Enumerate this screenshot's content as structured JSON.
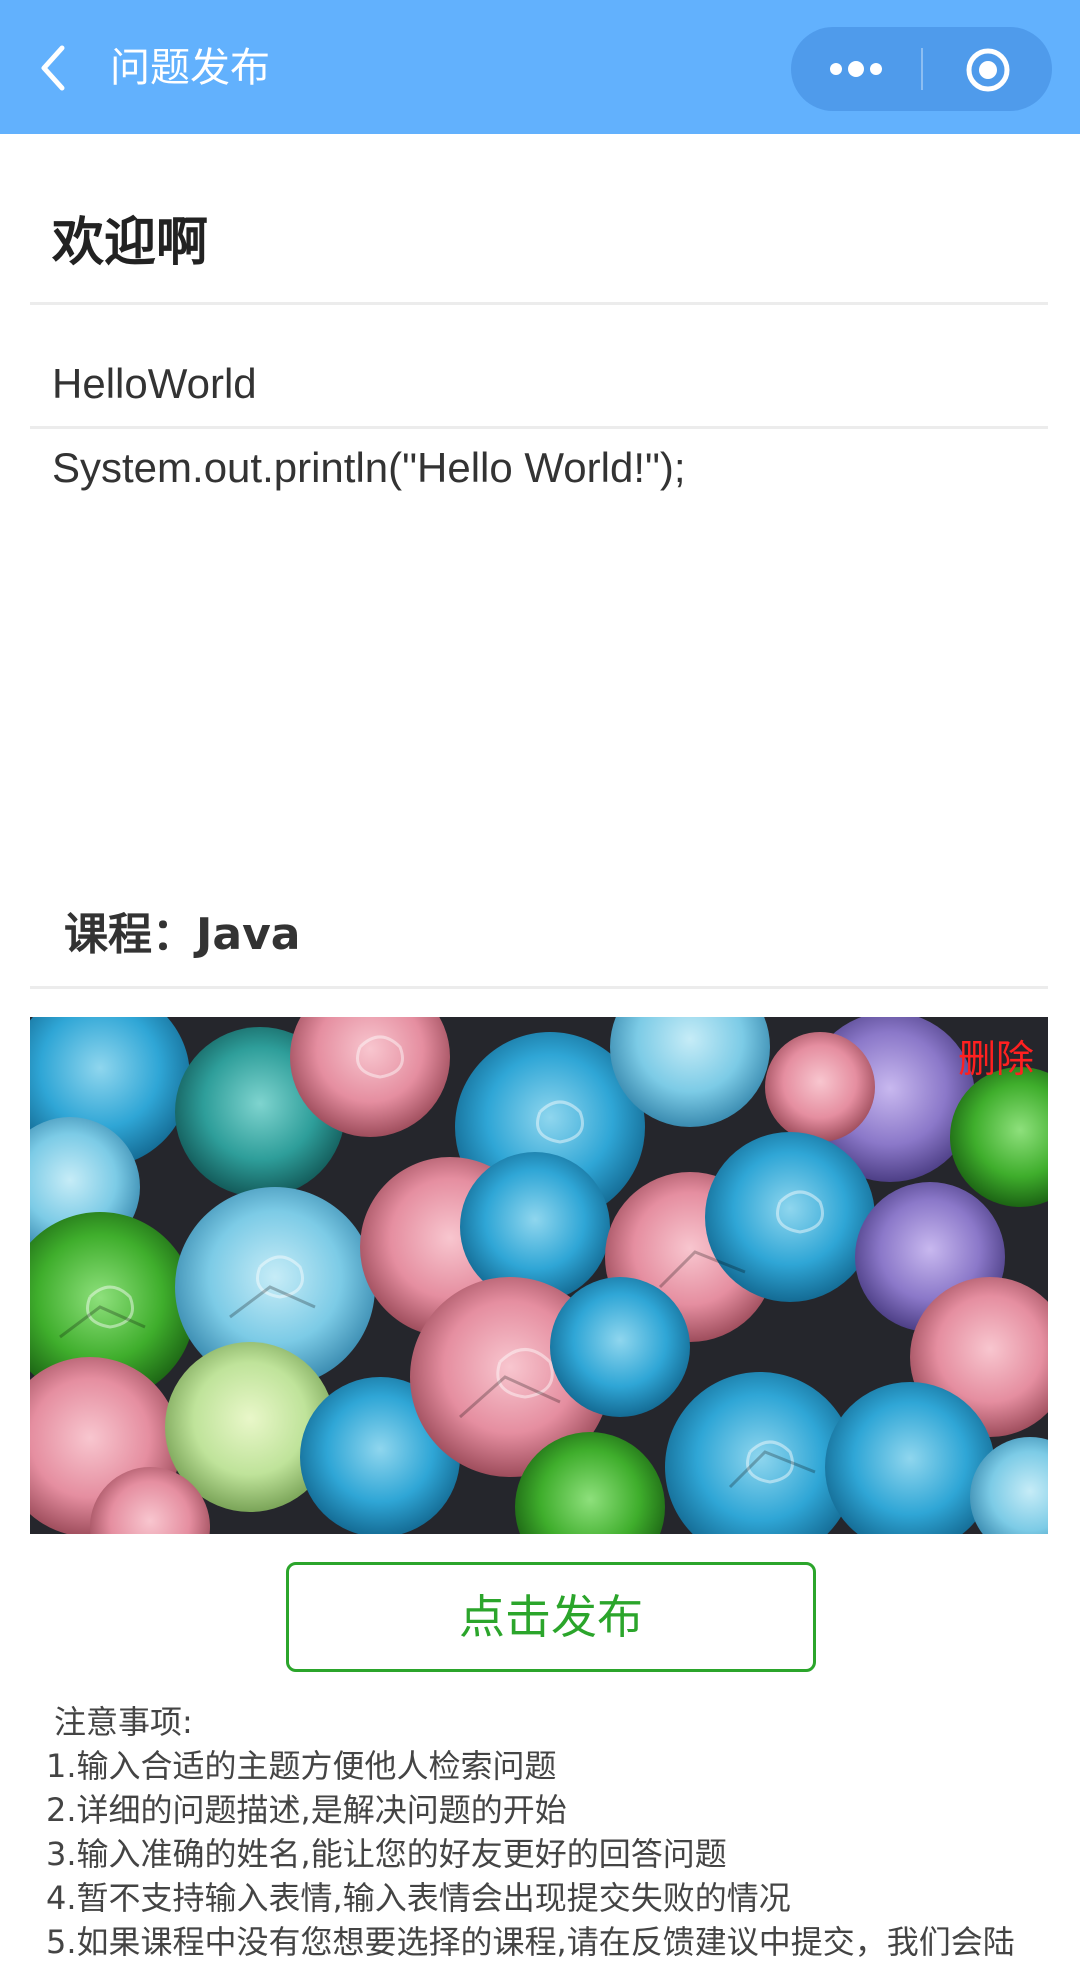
{
  "navbar": {
    "title": "问题发布",
    "back_icon": "chevron-left-icon",
    "more_icon": "more-dots-icon",
    "close_icon": "target-circle-icon",
    "background": "#62b1fd"
  },
  "form": {
    "welcome": "欢迎啊",
    "topic_value": "HelloWorld",
    "description_value": "System.out.println(\"Hello World!\");",
    "course_label": "课程：",
    "course_value": "Java"
  },
  "image": {
    "subject": "origami-paper-roses",
    "delete_label": "删除",
    "delete_color": "#ff2020"
  },
  "actions": {
    "publish_label": "点击发布",
    "publish_color": "#2ba52b"
  },
  "notes": {
    "title": "注意事项:",
    "items": [
      "1.输入合适的主题方便他人检索问题",
      "2.详细的问题描述,是解决问题的开始",
      "3.输入准确的姓名,能让您的好友更好的回答问题",
      "4.暂不支持输入表情,输入表情会出现提交失败的情况",
      "5.如果课程中没有您想要选择的课程,请在反馈建议中提交，我们会陆"
    ]
  }
}
